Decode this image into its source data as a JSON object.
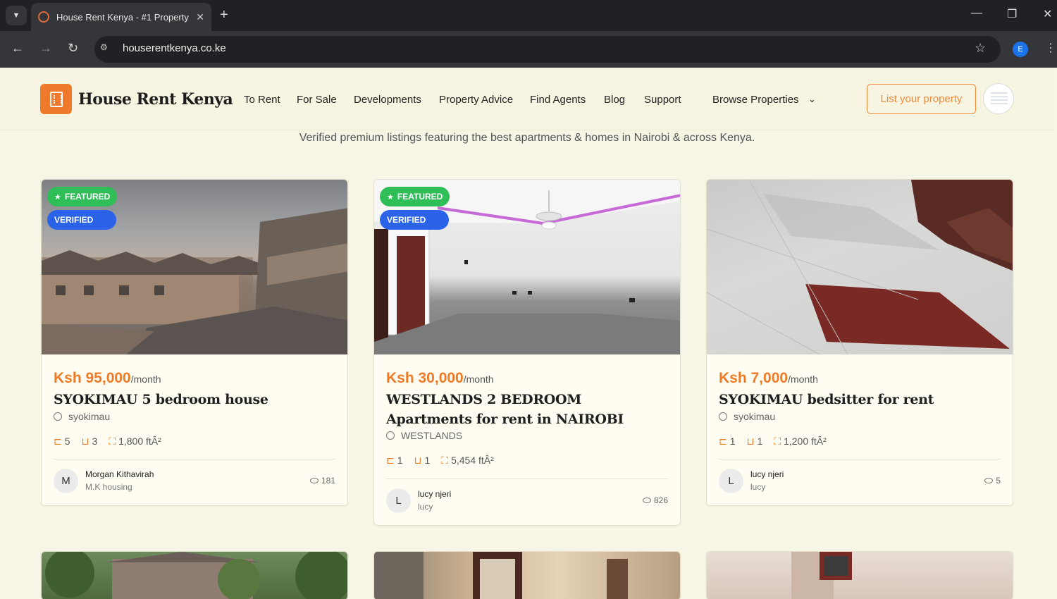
{
  "browser": {
    "tab_title": "House Rent Kenya - #1 Property",
    "url": "houserentkenya.co.ke",
    "profile_initial": "E"
  },
  "header": {
    "brand": "House Rent Kenya",
    "nav": [
      "To Rent",
      "For Sale",
      "Developments",
      "Property Advice",
      "Find Agents",
      "Blog",
      "Support",
      "Browse Properties"
    ],
    "cta": "List your property"
  },
  "subtitle": "Verified premium listings featuring the best apartments & homes in Nairobi & across Kenya.",
  "badges": {
    "featured": "FEATURED",
    "verified": "VERIFIED"
  },
  "listings": [
    {
      "price": "Ksh 95,000",
      "period": "/month",
      "title": "SYOKIMAU 5 bedroom house",
      "location": "syokimau",
      "beds": "5",
      "baths": "3",
      "area": "1,800 ftÂ²",
      "owner_initial": "M",
      "owner": "Morgan Kithavirah",
      "company": "M.K housing",
      "views": "181",
      "featured": true,
      "verified": true
    },
    {
      "price": "Ksh 30,000",
      "period": "/month",
      "title": "WESTLANDS 2 BEDROOM Apartments for rent in NAIROBI",
      "location": "WESTLANDS",
      "beds": "1",
      "baths": "1",
      "area": "5,454 ftÂ²",
      "owner_initial": "L",
      "owner": "lucy njeri",
      "company": "lucy",
      "views": "826",
      "featured": true,
      "verified": true
    },
    {
      "price": "Ksh 7,000",
      "period": "/month",
      "title": "SYOKIMAU bedsitter for rent",
      "location": "syokimau",
      "beds": "1",
      "baths": "1",
      "area": "1,200 ftÂ²",
      "owner_initial": "L",
      "owner": "lucy njeri",
      "company": "lucy",
      "views": "5",
      "featured": false,
      "verified": false
    }
  ]
}
